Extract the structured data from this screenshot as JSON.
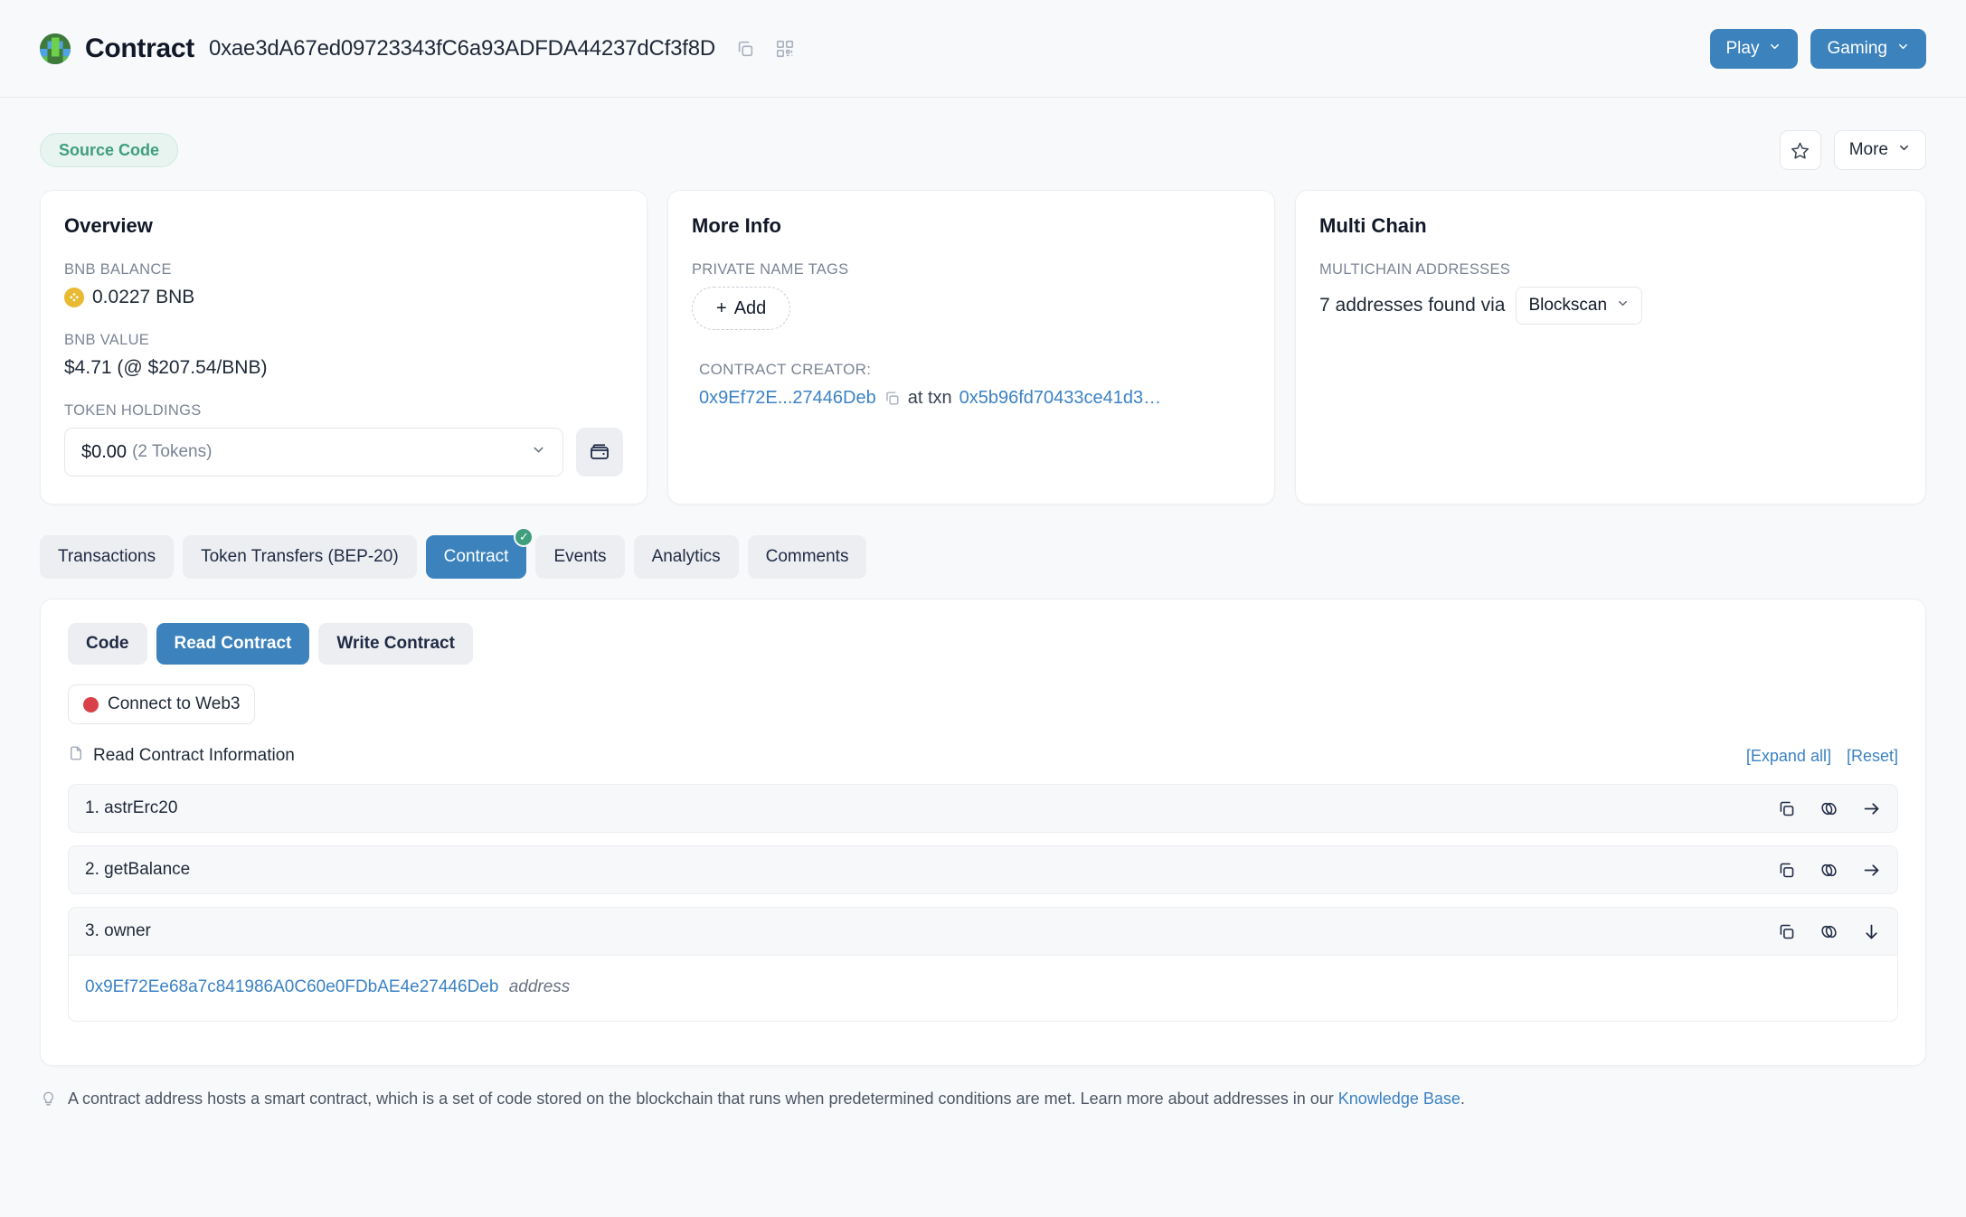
{
  "header": {
    "title": "Contract",
    "address": "0xae3dA67ed09723343fC6a93ADFDA44237dCf3f8D",
    "copy_icon": "copy-icon",
    "qr_icon": "qr-code-icon",
    "buttons": [
      {
        "label": "Play",
        "icon": "chevron-down-icon"
      },
      {
        "label": "Gaming",
        "icon": "chevron-down-icon"
      }
    ]
  },
  "badge_row": {
    "source_code": "Source Code",
    "star_icon": "star-icon",
    "more_label": "More"
  },
  "overview": {
    "title": "Overview",
    "bnb_balance_label": "BNB BALANCE",
    "bnb_balance_value": "0.0227 BNB",
    "bnb_value_label": "BNB VALUE",
    "bnb_value_value": "$4.71 (@ $207.54/BNB)",
    "token_holdings_label": "TOKEN HOLDINGS",
    "token_holdings_value": "$0.00",
    "token_holdings_count": "(2 Tokens)",
    "wallet_icon": "wallet-icon"
  },
  "more_info": {
    "title": "More Info",
    "private_name_tags_label": "PRIVATE NAME TAGS",
    "add_label": "Add",
    "contract_creator_label": "CONTRACT CREATOR:",
    "creator_address": "0x9Ef72E...27446Deb",
    "at_txn": "at txn",
    "txn_hash": "0x5b96fd70433ce41d3…"
  },
  "multi_chain": {
    "title": "Multi Chain",
    "multichain_addresses_label": "MULTICHAIN ADDRESSES",
    "found_text": "7 addresses found via",
    "provider": "Blockscan"
  },
  "tabs": [
    {
      "label": "Transactions",
      "active": false
    },
    {
      "label": "Token Transfers (BEP-20)",
      "active": false
    },
    {
      "label": "Contract",
      "active": true,
      "badge": "✓"
    },
    {
      "label": "Events",
      "active": false
    },
    {
      "label": "Analytics",
      "active": false
    },
    {
      "label": "Comments",
      "active": false
    }
  ],
  "contract_panel": {
    "subtabs": [
      {
        "label": "Code",
        "active": false
      },
      {
        "label": "Read Contract",
        "active": true
      },
      {
        "label": "Write Contract",
        "active": false
      }
    ],
    "connect_label": "Connect to Web3",
    "read_info_label": "Read Contract Information",
    "expand_all": "[Expand all]",
    "reset": "[Reset]",
    "functions": [
      {
        "label": "1. astrErc20",
        "expanded": false,
        "arrow": "arrow-right-icon"
      },
      {
        "label": "2. getBalance",
        "expanded": false,
        "arrow": "arrow-right-icon"
      },
      {
        "label": "3. owner",
        "expanded": true,
        "arrow": "arrow-down-icon",
        "result_value": "0x9Ef72Ee68a7c841986A0C60e0FDbAE4e27446Deb",
        "result_type": "address"
      }
    ]
  },
  "footer": {
    "text": "A contract address hosts a smart contract, which is a set of code stored on the blockchain that runs when predetermined conditions are met. Learn more about addresses in our ",
    "link": "Knowledge Base",
    "period": "."
  },
  "colors": {
    "accent_blue": "#3c82bd",
    "link_blue": "#3b82c4",
    "green": "#3f9e7d",
    "red": "#d9414a",
    "page_bg": "#f8f9fb"
  }
}
